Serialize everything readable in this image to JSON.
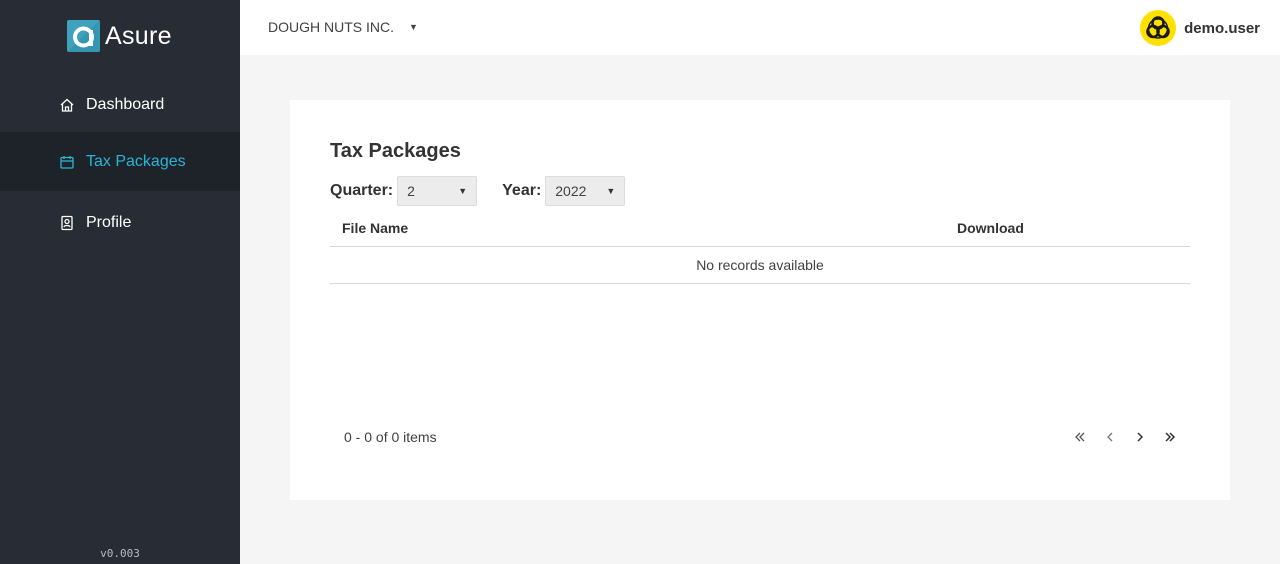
{
  "sidebar": {
    "logo_text": "Asure",
    "items": [
      {
        "label": "Dashboard",
        "icon": "home-icon",
        "active": false
      },
      {
        "label": "Tax Packages",
        "icon": "calendar-icon",
        "active": true
      },
      {
        "label": "Profile",
        "icon": "badge-icon",
        "active": false
      }
    ],
    "version": "v0.003"
  },
  "header": {
    "company": "DOUGH NUTS INC.",
    "username": "demo.user",
    "avatar_icon": "biohazard-icon"
  },
  "main": {
    "title": "Tax Packages",
    "filters": {
      "quarter_label": "Quarter:",
      "quarter_value": "2",
      "year_label": "Year:",
      "year_value": "2022"
    },
    "grid": {
      "columns": [
        "File Name",
        "Download"
      ],
      "empty_message": "No records available"
    },
    "pager": {
      "info": "0 - 0 of 0 items"
    }
  },
  "colors": {
    "sidebar_bg": "#282d35",
    "sidebar_active_bg": "#1e232a",
    "accent": "#2ab4d8",
    "avatar_bg": "#ffe000"
  }
}
